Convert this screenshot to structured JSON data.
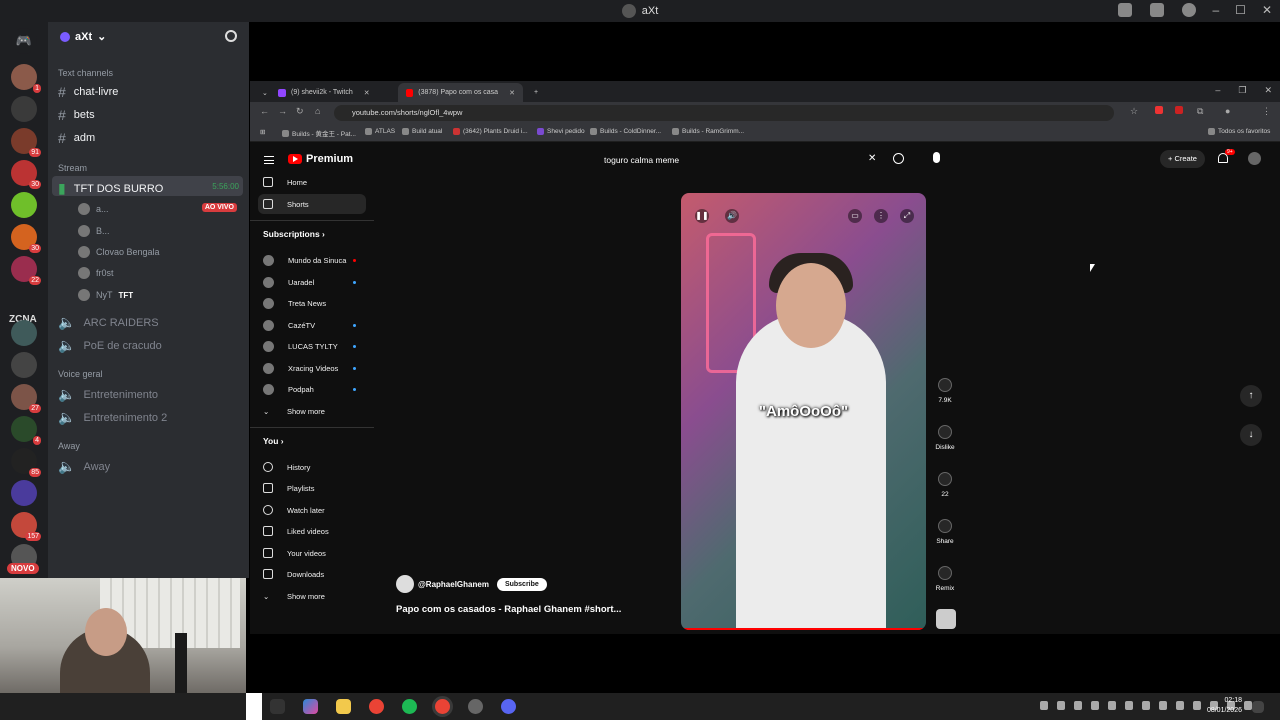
{
  "discord": {
    "window_title": "aXt",
    "server_name": "aXt",
    "zcna_label": "ZCNA",
    "novo_label": "NOVO",
    "server_badges": [
      "1",
      "",
      "91",
      "30",
      "",
      "30",
      "22",
      "",
      "",
      "",
      "27",
      "4",
      "85",
      "",
      "157"
    ],
    "categories": {
      "text": "Text channels",
      "stream": "Stream",
      "voice": "Voice geral",
      "away": "Away"
    },
    "text_channels": [
      "chat-livre",
      "bets",
      "adm"
    ],
    "stream_channel": {
      "name": "TFT DOS BURRO",
      "timer": "5:56:00"
    },
    "stream_users": [
      {
        "name": "a...",
        "badge": "AO VIVO"
      },
      {
        "name": "B..."
      },
      {
        "name": "Clovao Bengala"
      },
      {
        "name": "fr0st"
      },
      {
        "name": "NyT",
        "tag": "TFT"
      }
    ],
    "voice_channels_stream": [
      "ARC RAIDERS",
      "PoE de cracudo"
    ],
    "voice_channels_general": [
      "Entretenimento",
      "Entretenimento 2"
    ],
    "voice_channels_away": [
      "Away"
    ]
  },
  "browser": {
    "tabs": [
      {
        "label": "(9) shevii2k - Twitch",
        "color": "#9146ff"
      },
      {
        "label": "(3878) Papo com os casado",
        "color": "#ff0000"
      }
    ],
    "url": "youtube.com/shorts/nglOfl_4wpw",
    "bookmarks": [
      "Builds - 黄金王 - Pat...",
      "ATLAS",
      "Build atual",
      "(3642) Plants Druid i...",
      "Shevi pedido",
      "Builds - ColdDinner...",
      "Builds - RamGrimm..."
    ],
    "bookmarks_right": "Todos os favoritos"
  },
  "youtube": {
    "logo": "Premium",
    "search_value": "toguro calma meme",
    "create_label": "Create",
    "notif_count": "9+",
    "nav": [
      "Home",
      "Shorts"
    ],
    "subscriptions_heading": "Subscriptions",
    "subscriptions": [
      "Mundo da Sinuca",
      "Uaradel",
      "Treta News",
      "CazéTV",
      "LUCAS TYLTY",
      "Xracing Videos",
      "Podpah"
    ],
    "show_more": "Show more",
    "you_heading": "You",
    "you_items": [
      "History",
      "Playlists",
      "Watch later",
      "Liked videos",
      "Your videos",
      "Downloads"
    ],
    "video": {
      "caption": "\"AmôOoOô\"",
      "channel": "@RaphaelGhanem",
      "subscribe": "Subscribe",
      "title": "Papo com os casados - Raphael Ghanem #short..."
    },
    "actions": {
      "likes": "7.9K",
      "dislike": "Dislike",
      "comments": "22",
      "share": "Share",
      "remix": "Remix"
    }
  },
  "taskbar": {
    "time": "02:18",
    "date": "08/01/2026"
  }
}
